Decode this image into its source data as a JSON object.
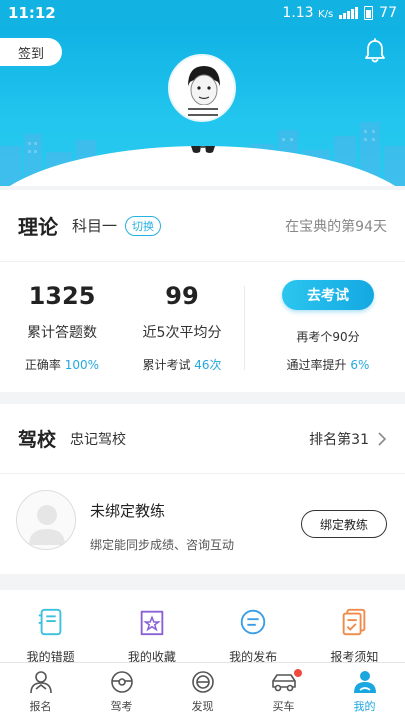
{
  "status_bar": {
    "time": "11:12",
    "speed": "1.13",
    "speed_unit": "K/s",
    "battery": "77"
  },
  "header": {
    "checkin_label": "签到"
  },
  "theory": {
    "title": "理论",
    "subject": "科目一",
    "switch_label": "切换",
    "days_text": "在宝典的第94天",
    "answered_count": "1325",
    "answered_label": "累计答题数",
    "accuracy_label": "正确率",
    "accuracy_value": "100%",
    "avg_score": "99",
    "avg_label": "近5次平均分",
    "exam_count_label": "累计考试",
    "exam_count_value": "46次",
    "exam_button": "去考试",
    "retest_text": "再考个90分",
    "pass_rate_label": "通过率提升",
    "pass_rate_value": "6%"
  },
  "school": {
    "title": "驾校",
    "name": "忠记驾校",
    "rank": "排名第31",
    "coach_title": "未绑定教练",
    "coach_sub": "绑定能同步成绩、咨询互动",
    "bind_button": "绑定教练"
  },
  "menu": [
    {
      "icon": "notebook-icon",
      "label": "我的错题"
    },
    {
      "icon": "favorite-star-icon",
      "label": "我的收藏"
    },
    {
      "icon": "message-icon",
      "label": "我的发布"
    },
    {
      "icon": "checklist-icon",
      "label": "报考须知"
    }
  ],
  "bottom_nav": [
    {
      "icon": "signup-icon",
      "label": "报名"
    },
    {
      "icon": "steering-wheel-icon",
      "label": "驾考"
    },
    {
      "icon": "discover-icon",
      "label": "发现"
    },
    {
      "icon": "car-icon",
      "label": "买车"
    },
    {
      "icon": "profile-icon",
      "label": "我的"
    }
  ],
  "colors": {
    "accent": "#1aa7e0",
    "header": "#12b3e3",
    "badge": "#f04a3e"
  }
}
